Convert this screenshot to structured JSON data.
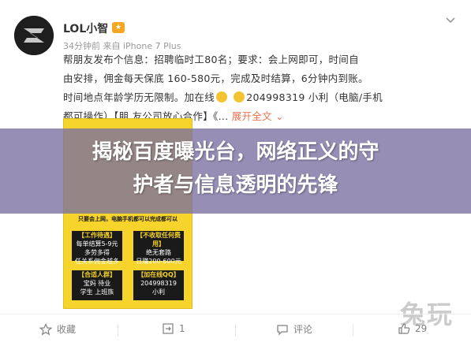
{
  "post": {
    "username": "LOL小智",
    "meta": "34分钟前 来自 iPhone 7 Plus",
    "text_lines": [
      "帮朋友发布个信息：招聘临时工80名；要求：会上网即可，时间自",
      "由安排，佣金每天保底 160-580元，完成及时结算，6分钟内到账。",
      "时间地点年龄学历无限制。加在线",
      "204998319 小利（电脑/手机",
      "都可操作）【朋 友公司放心合作】《...",
      "展开全文"
    ]
  },
  "image": {
    "boxes": [
      {
        "title": "【工作待遇】",
        "body": "每单结算5-9元\n多劳多得\n任关系佣金越多"
      },
      {
        "title": "【不收取任何费用】",
        "body": "绝无套路\n日赚200-600元"
      },
      {
        "title": "【合适人群】",
        "body": "宝妈  待业\n学生  上班族"
      },
      {
        "title": "【加在线QQ】",
        "body": "204998319\n小利"
      }
    ],
    "mid_text": "只要会上网，电脑手机都可以完成都可以"
  },
  "banner": {
    "title_line1": "揭秘百度曝光台，网络正义的守",
    "title_line2": "护者与信息透明的先锋"
  },
  "watermark": "兔玩",
  "actions": {
    "collect": "收藏",
    "repost": "1",
    "comment": "评论",
    "like": "29"
  }
}
